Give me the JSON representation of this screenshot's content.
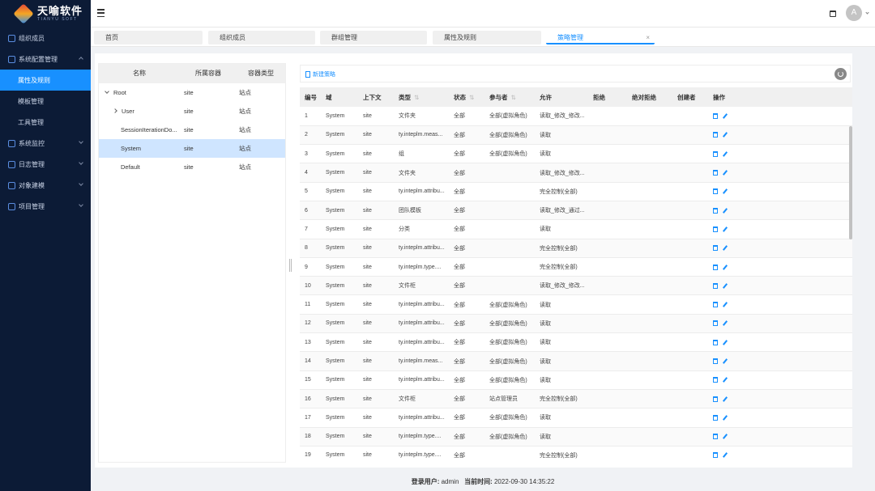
{
  "brand": {
    "name": "天喻软件",
    "sub": "TIANYU SOFT"
  },
  "sidebar": {
    "items": [
      {
        "label": "组织成员",
        "type": "top"
      },
      {
        "label": "系统配置管理",
        "type": "top",
        "expanded": true
      },
      {
        "label": "属性及规则",
        "type": "sub",
        "active": true
      },
      {
        "label": "模板管理",
        "type": "sub"
      },
      {
        "label": "工具管理",
        "type": "sub"
      },
      {
        "label": "系统监控",
        "type": "top"
      },
      {
        "label": "日志管理",
        "type": "top"
      },
      {
        "label": "对象建模",
        "type": "top"
      },
      {
        "label": "项目管理",
        "type": "top"
      }
    ]
  },
  "topbar": {
    "avatar_initial": "A"
  },
  "tabs": [
    {
      "label": "首页"
    },
    {
      "label": "组织成员"
    },
    {
      "label": "群组管理"
    },
    {
      "label": "属性及规则"
    },
    {
      "label": "策略管理",
      "active": true,
      "close": "×"
    }
  ],
  "tree": {
    "headers": {
      "name": "名称",
      "container": "所属容器",
      "type": "容器类型"
    },
    "rows": [
      {
        "name": "Root",
        "container": "site",
        "type": "站点",
        "caret": "down",
        "indent": 0
      },
      {
        "name": "User",
        "container": "site",
        "type": "站点",
        "caret": "right",
        "indent": 1
      },
      {
        "name": "SessionIterationDo...",
        "container": "site",
        "type": "站点",
        "indent": 1
      },
      {
        "name": "System",
        "container": "site",
        "type": "站点",
        "indent": 1,
        "selected": true
      },
      {
        "name": "Default",
        "container": "site",
        "type": "站点",
        "indent": 1
      }
    ]
  },
  "policy": {
    "new_label": "新建策略",
    "headers": {
      "no": "编号",
      "domain": "域",
      "context": "上下文",
      "type": "类型",
      "status": "状态",
      "participant": "参与者",
      "allow": "允许",
      "deny": "拒绝",
      "absdeny": "绝对拒绝",
      "creator": "创建者",
      "op": "操作"
    },
    "rows": [
      [
        "1",
        "System",
        "site",
        "文件夹",
        "全部",
        "全部(虚拟角色)",
        "读取_修改_修改..."
      ],
      [
        "2",
        "System",
        "site",
        "ty.inteplm.meas...",
        "全部",
        "全部(虚拟角色)",
        "读取"
      ],
      [
        "3",
        "System",
        "site",
        "组",
        "全部",
        "全部(虚拟角色)",
        "读取"
      ],
      [
        "4",
        "System",
        "site",
        "文件夹",
        "全部",
        "",
        "读取_修改_修改..."
      ],
      [
        "5",
        "System",
        "site",
        "ty.inteplm.attribu...",
        "全部",
        "",
        "完全控制(全部)"
      ],
      [
        "6",
        "System",
        "site",
        "团队模板",
        "全部",
        "",
        "读取_修改_通过..."
      ],
      [
        "7",
        "System",
        "site",
        "分类",
        "全部",
        "",
        "读取"
      ],
      [
        "8",
        "System",
        "site",
        "ty.inteplm.attribu...",
        "全部",
        "",
        "完全控制(全部)"
      ],
      [
        "9",
        "System",
        "site",
        "ty.inteplm.type....",
        "全部",
        "",
        "完全控制(全部)"
      ],
      [
        "10",
        "System",
        "site",
        "文件柜",
        "全部",
        "",
        "读取_修改_修改..."
      ],
      [
        "11",
        "System",
        "site",
        "ty.inteplm.attribu...",
        "全部",
        "全部(虚拟角色)",
        "读取"
      ],
      [
        "12",
        "System",
        "site",
        "ty.inteplm.attribu...",
        "全部",
        "全部(虚拟角色)",
        "读取"
      ],
      [
        "13",
        "System",
        "site",
        "ty.inteplm.attribu...",
        "全部",
        "全部(虚拟角色)",
        "读取"
      ],
      [
        "14",
        "System",
        "site",
        "ty.inteplm.meas...",
        "全部",
        "全部(虚拟角色)",
        "读取"
      ],
      [
        "15",
        "System",
        "site",
        "ty.inteplm.attribu...",
        "全部",
        "全部(虚拟角色)",
        "读取"
      ],
      [
        "16",
        "System",
        "site",
        "文件柜",
        "全部",
        "站点管理员",
        "完全控制(全部)"
      ],
      [
        "17",
        "System",
        "site",
        "ty.inteplm.attribu...",
        "全部",
        "全部(虚拟角色)",
        "读取"
      ],
      [
        "18",
        "System",
        "site",
        "ty.inteplm.type....",
        "全部",
        "全部(虚拟角色)",
        "读取"
      ],
      [
        "19",
        "System",
        "site",
        "ty.inteplm.type....",
        "全部",
        "",
        "完全控制(全部)"
      ]
    ]
  },
  "footer": {
    "user_label": "登录用户:",
    "user": "admin",
    "time_label": "当前时间:",
    "time": "2022-09-30 14:35:22"
  }
}
